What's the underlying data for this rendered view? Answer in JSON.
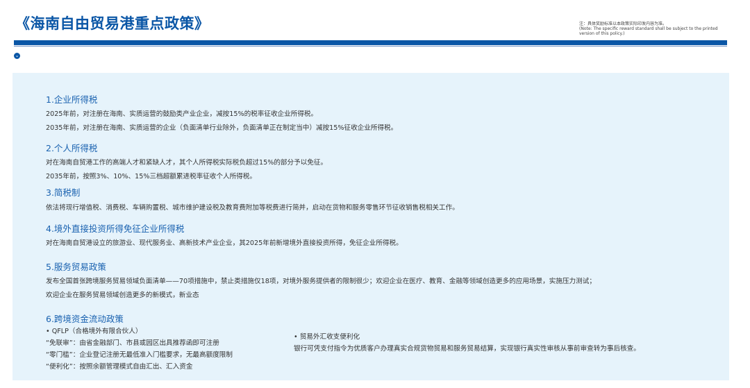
{
  "title": "《海南自由贸易港重点政策》",
  "note": {
    "cn": "注：具体奖励标准以本政策实际印发内容为准。",
    "en": "(Note: The specific reward standard shall be subject to the printed version of this policy.)"
  },
  "sections": {
    "s1": {
      "heading": "1.企业所得税",
      "lines": [
        "2025年前，对注册在海南、实质运营的鼓励类产业企业，减按15%的税率征收企业所得税。",
        "2035年前，对注册在海南、实质运营的企业（负面清单行业除外，负面清单正在制定当中）减按15%征收企业所得税。"
      ]
    },
    "s2": {
      "heading": "2.个人所得税",
      "lines": [
        "对在海南自贸港工作的高端人才和紧缺人才，其个人所得税实际税负超过15%的部分予以免征。",
        "2035年前，按照3%、10%、15%三档超额累进税率征收个人所得税。"
      ]
    },
    "s3": {
      "heading": "3.简税制",
      "lines": [
        "依法将现行增值税、消费税、车辆购置税、城市维护建设税及教育费附加等税费进行简并，启动在货物和服务零售环节征收销售税相关工作。"
      ]
    },
    "s4": {
      "heading": "4.境外直接投资所得免征企业所得税",
      "lines": [
        "对在海南自贸港设立的旅游业、现代服务业、高新技术产业企业，其2025年前新增境外直接投资所得，免征企业所得税。"
      ]
    },
    "s5": {
      "heading": "5.服务贸易政策",
      "lines": [
        "发布全国首张跨境服务贸易领域负面清单——70项措施中，禁止类措施仅18项，对境外服务提供者的限制很少；欢迎企业在医疗、教育、金融等领域创造更多的应用场景，实施压力测试；",
        "欢迎企业在服务贸易领域创造更多的新模式，新业态"
      ]
    },
    "s6": {
      "heading": "6.跨境资金流动政策",
      "left": [
        "•  QFLP（合格境外有限合伙人）",
        "“免联审”：由省金融部门、市县或园区出具推荐函即可注册",
        "“零门槛”：企业登记注册无最低准入门槛要求，无最高额度限制",
        "“便利化”：按照余额管理模式自由汇出、汇入资金"
      ],
      "right_title": "•  贸易外汇收支便利化",
      "right_text": "银行可凭支付指令为优质客户办理真实合规货物贸易和服务贸易结算，实现银行真实性审核从事前审查转为事后核查。"
    }
  }
}
